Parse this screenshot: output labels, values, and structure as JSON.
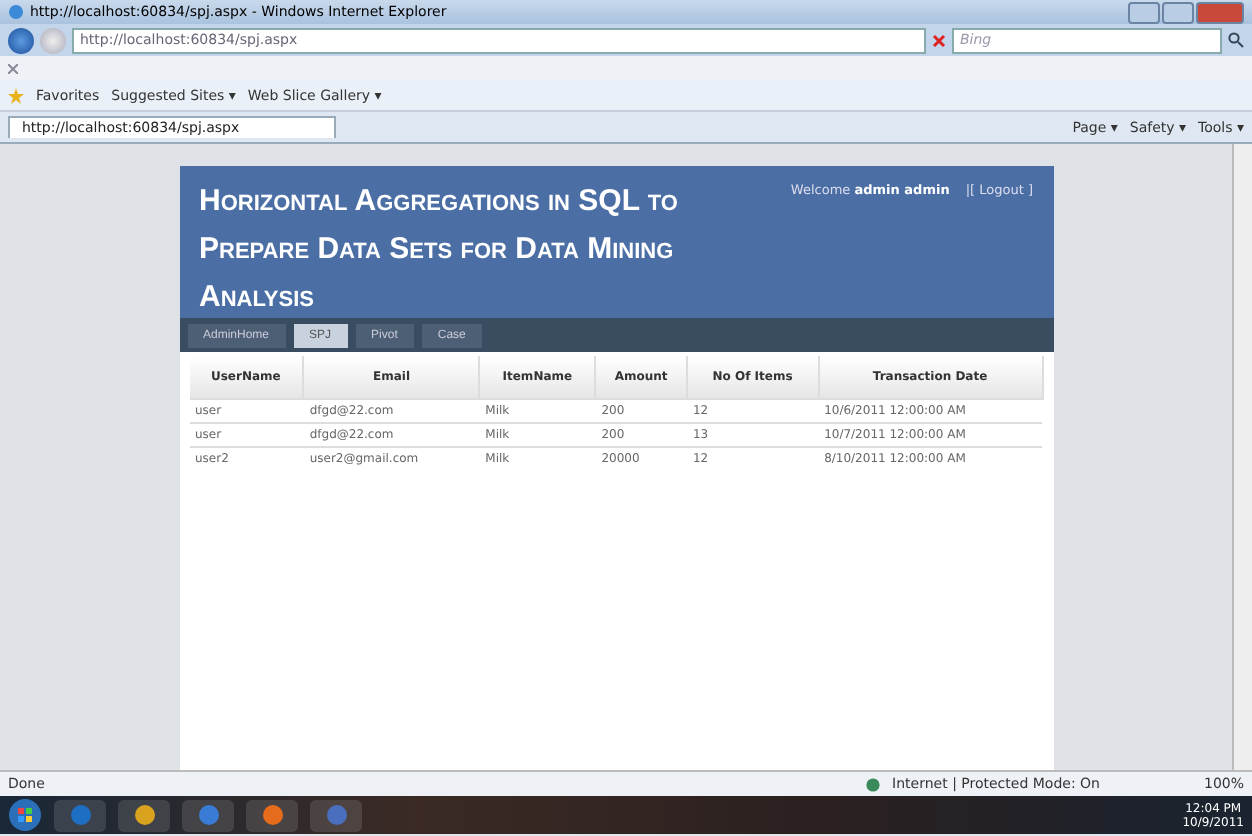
{
  "window": {
    "title": "http://localhost:60834/spj.aspx - Windows Internet Explorer"
  },
  "address_bar": {
    "url": "http://localhost:60834/spj.aspx",
    "search_placeholder": "Bing"
  },
  "favorites_bar": {
    "label": "Favorites",
    "links": [
      "Suggested Sites ▾",
      "Web Slice Gallery ▾"
    ]
  },
  "tab": {
    "title": "http://localhost:60834/spj.aspx"
  },
  "command_bar": [
    "Page ▾",
    "Safety ▾",
    "Tools ▾"
  ],
  "page": {
    "heading": "Horizontal Aggregations in SQL to Prepare Data Sets for Data Mining Analysis",
    "welcome": "Welcome **admin admin**",
    "logout": "|[ Logout ]",
    "nav": [
      {
        "label": "AdminHome",
        "selected": false
      },
      {
        "label": "SPJ",
        "selected": true
      },
      {
        "label": "Pivot",
        "selected": false
      },
      {
        "label": "Case",
        "selected": false
      }
    ],
    "table": {
      "columns": [
        "UserName",
        "Email",
        "ItemName",
        "Amount",
        "No Of Items",
        "Transaction Date"
      ],
      "rows": [
        [
          "user",
          "dfgd@22.com",
          "Milk",
          "200",
          "12",
          "10/6/2011 12:00:00 AM"
        ],
        [
          "user",
          "dfgd@22.com",
          "Milk",
          "200",
          "13",
          "10/7/2011 12:00:00 AM"
        ],
        [
          "user2",
          "user2@gmail.com",
          "Milk",
          "20000",
          "12",
          "8/10/2011 12:00:00 AM"
        ]
      ]
    }
  },
  "status_bar": {
    "status": "Done",
    "zone": "Internet | Protected Mode: On",
    "zoom": "100%"
  },
  "taskbar": {
    "time": "12:04 PM",
    "date": "10/9/2011"
  }
}
